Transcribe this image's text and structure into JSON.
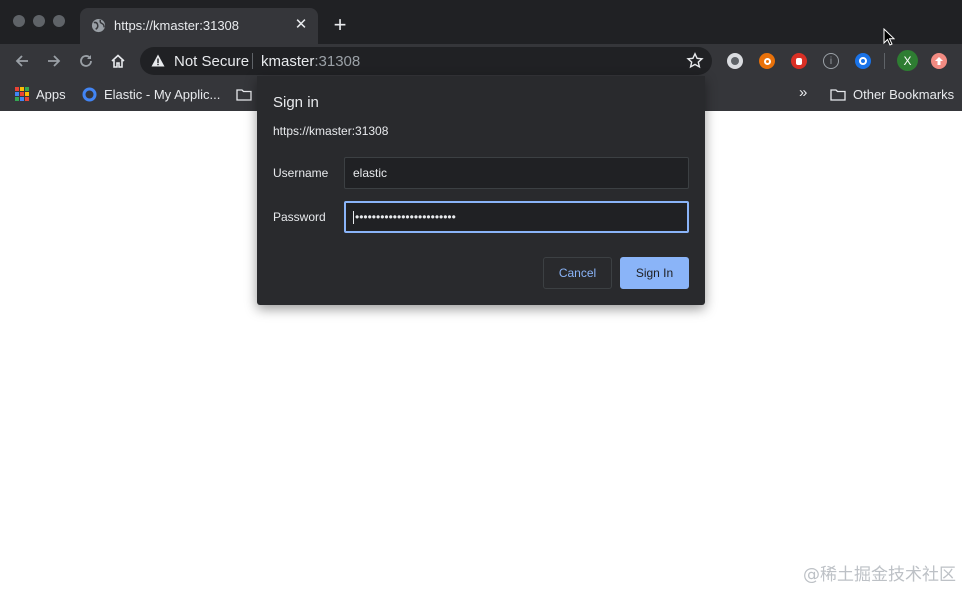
{
  "tab": {
    "title": "https://kmaster:31308"
  },
  "omnibox": {
    "security_label": "Not Secure",
    "host": "kmaster",
    "port": ":31308"
  },
  "bookmarks": {
    "apps_label": "Apps",
    "elastic_label": "Elastic - My Applic...",
    "other_label": "Other Bookmarks"
  },
  "extensions": {
    "x_label": "X"
  },
  "dialog": {
    "title": "Sign in",
    "url": "https://kmaster:31308",
    "username_label": "Username",
    "username_value": "elastic",
    "password_label": "Password",
    "password_value": "••••••••••••••••••••••••",
    "cancel_label": "Cancel",
    "signin_label": "Sign In"
  },
  "colors": {
    "titlebar": "#202124",
    "toolbar": "#35363a",
    "dialog": "#292a2d",
    "accent": "#8ab4f8"
  },
  "watermark": "@稀土掘金技术社区"
}
